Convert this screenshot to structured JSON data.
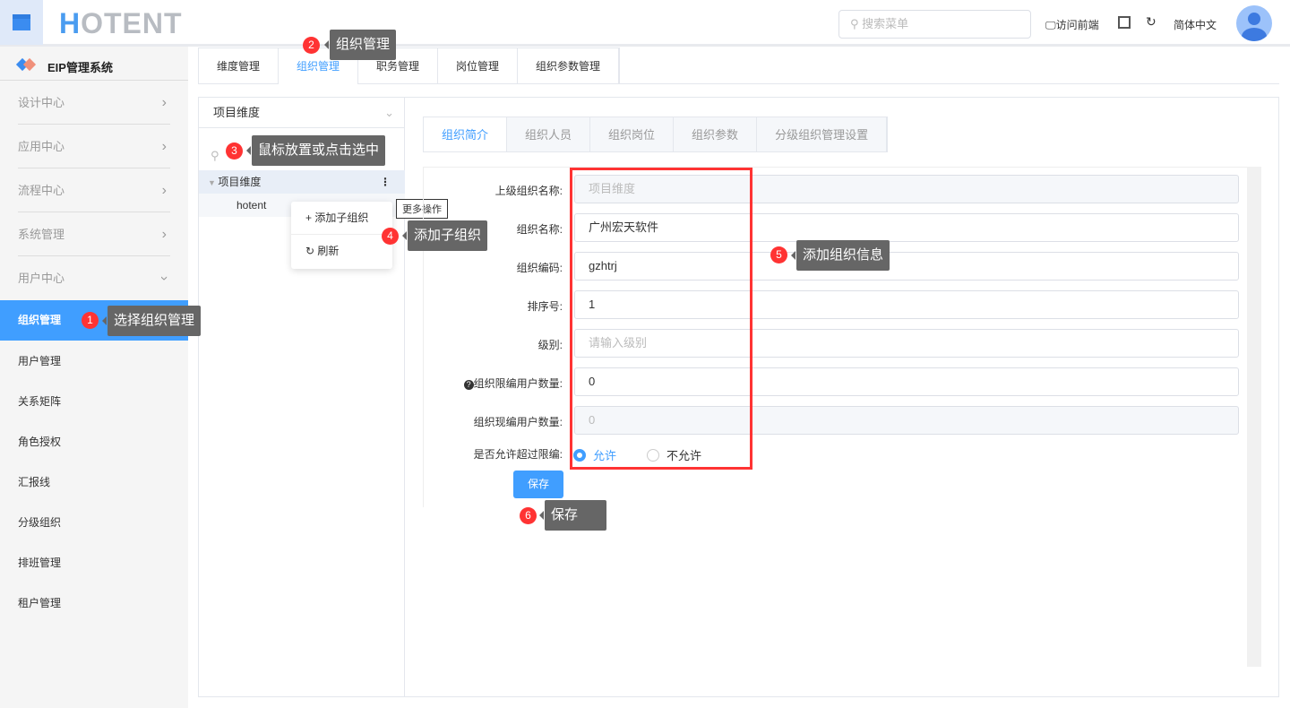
{
  "header": {
    "logo": "HOTENT",
    "search_placeholder": "搜索菜单",
    "visit_frontend": "访问前端",
    "language": "简体中文"
  },
  "sidebar": {
    "title": "EIP管理系统",
    "groups": [
      "设计中心",
      "应用中心",
      "流程中心",
      "系统管理",
      "用户中心"
    ],
    "items": [
      "组织管理",
      "用户管理",
      "关系矩阵",
      "角色授权",
      "汇报线",
      "分级组织",
      "排班管理",
      "租户管理"
    ]
  },
  "main_tabs": [
    "维度管理",
    "组织管理",
    "职务管理",
    "岗位管理",
    "组织参数管理"
  ],
  "tree": {
    "dimension": "项目维度",
    "root": "项目维度",
    "child": "hotent",
    "menu": {
      "add": "添加子组织",
      "refresh": "刷新"
    },
    "more_tip": "更多操作"
  },
  "form_tabs": [
    "组织简介",
    "组织人员",
    "组织岗位",
    "组织参数",
    "分级组织管理设置"
  ],
  "form": {
    "parent_label": "上级组织名称:",
    "parent_value": "项目维度",
    "name_label": "组织名称:",
    "name_value": "广州宏天软件",
    "code_label": "组织编码:",
    "code_value": "gzhtrj",
    "order_label": "排序号:",
    "order_value": "1",
    "level_label": "级别:",
    "level_placeholder": "请输入级别",
    "limit_label": "组织限编用户数量:",
    "limit_value": "0",
    "current_label": "组织现编用户数量:",
    "current_value": "0",
    "exceed_label": "是否允许超过限编:",
    "allow": "允许",
    "disallow": "不允许",
    "save": "保存"
  },
  "annotations": [
    {
      "n": "1",
      "text": "选择组织管理"
    },
    {
      "n": "2",
      "text": "组织管理"
    },
    {
      "n": "3",
      "text": "鼠标放置或点击选中"
    },
    {
      "n": "4",
      "text": "添加子组织"
    },
    {
      "n": "5",
      "text": "添加组织信息"
    },
    {
      "n": "6",
      "text": "保存"
    }
  ]
}
